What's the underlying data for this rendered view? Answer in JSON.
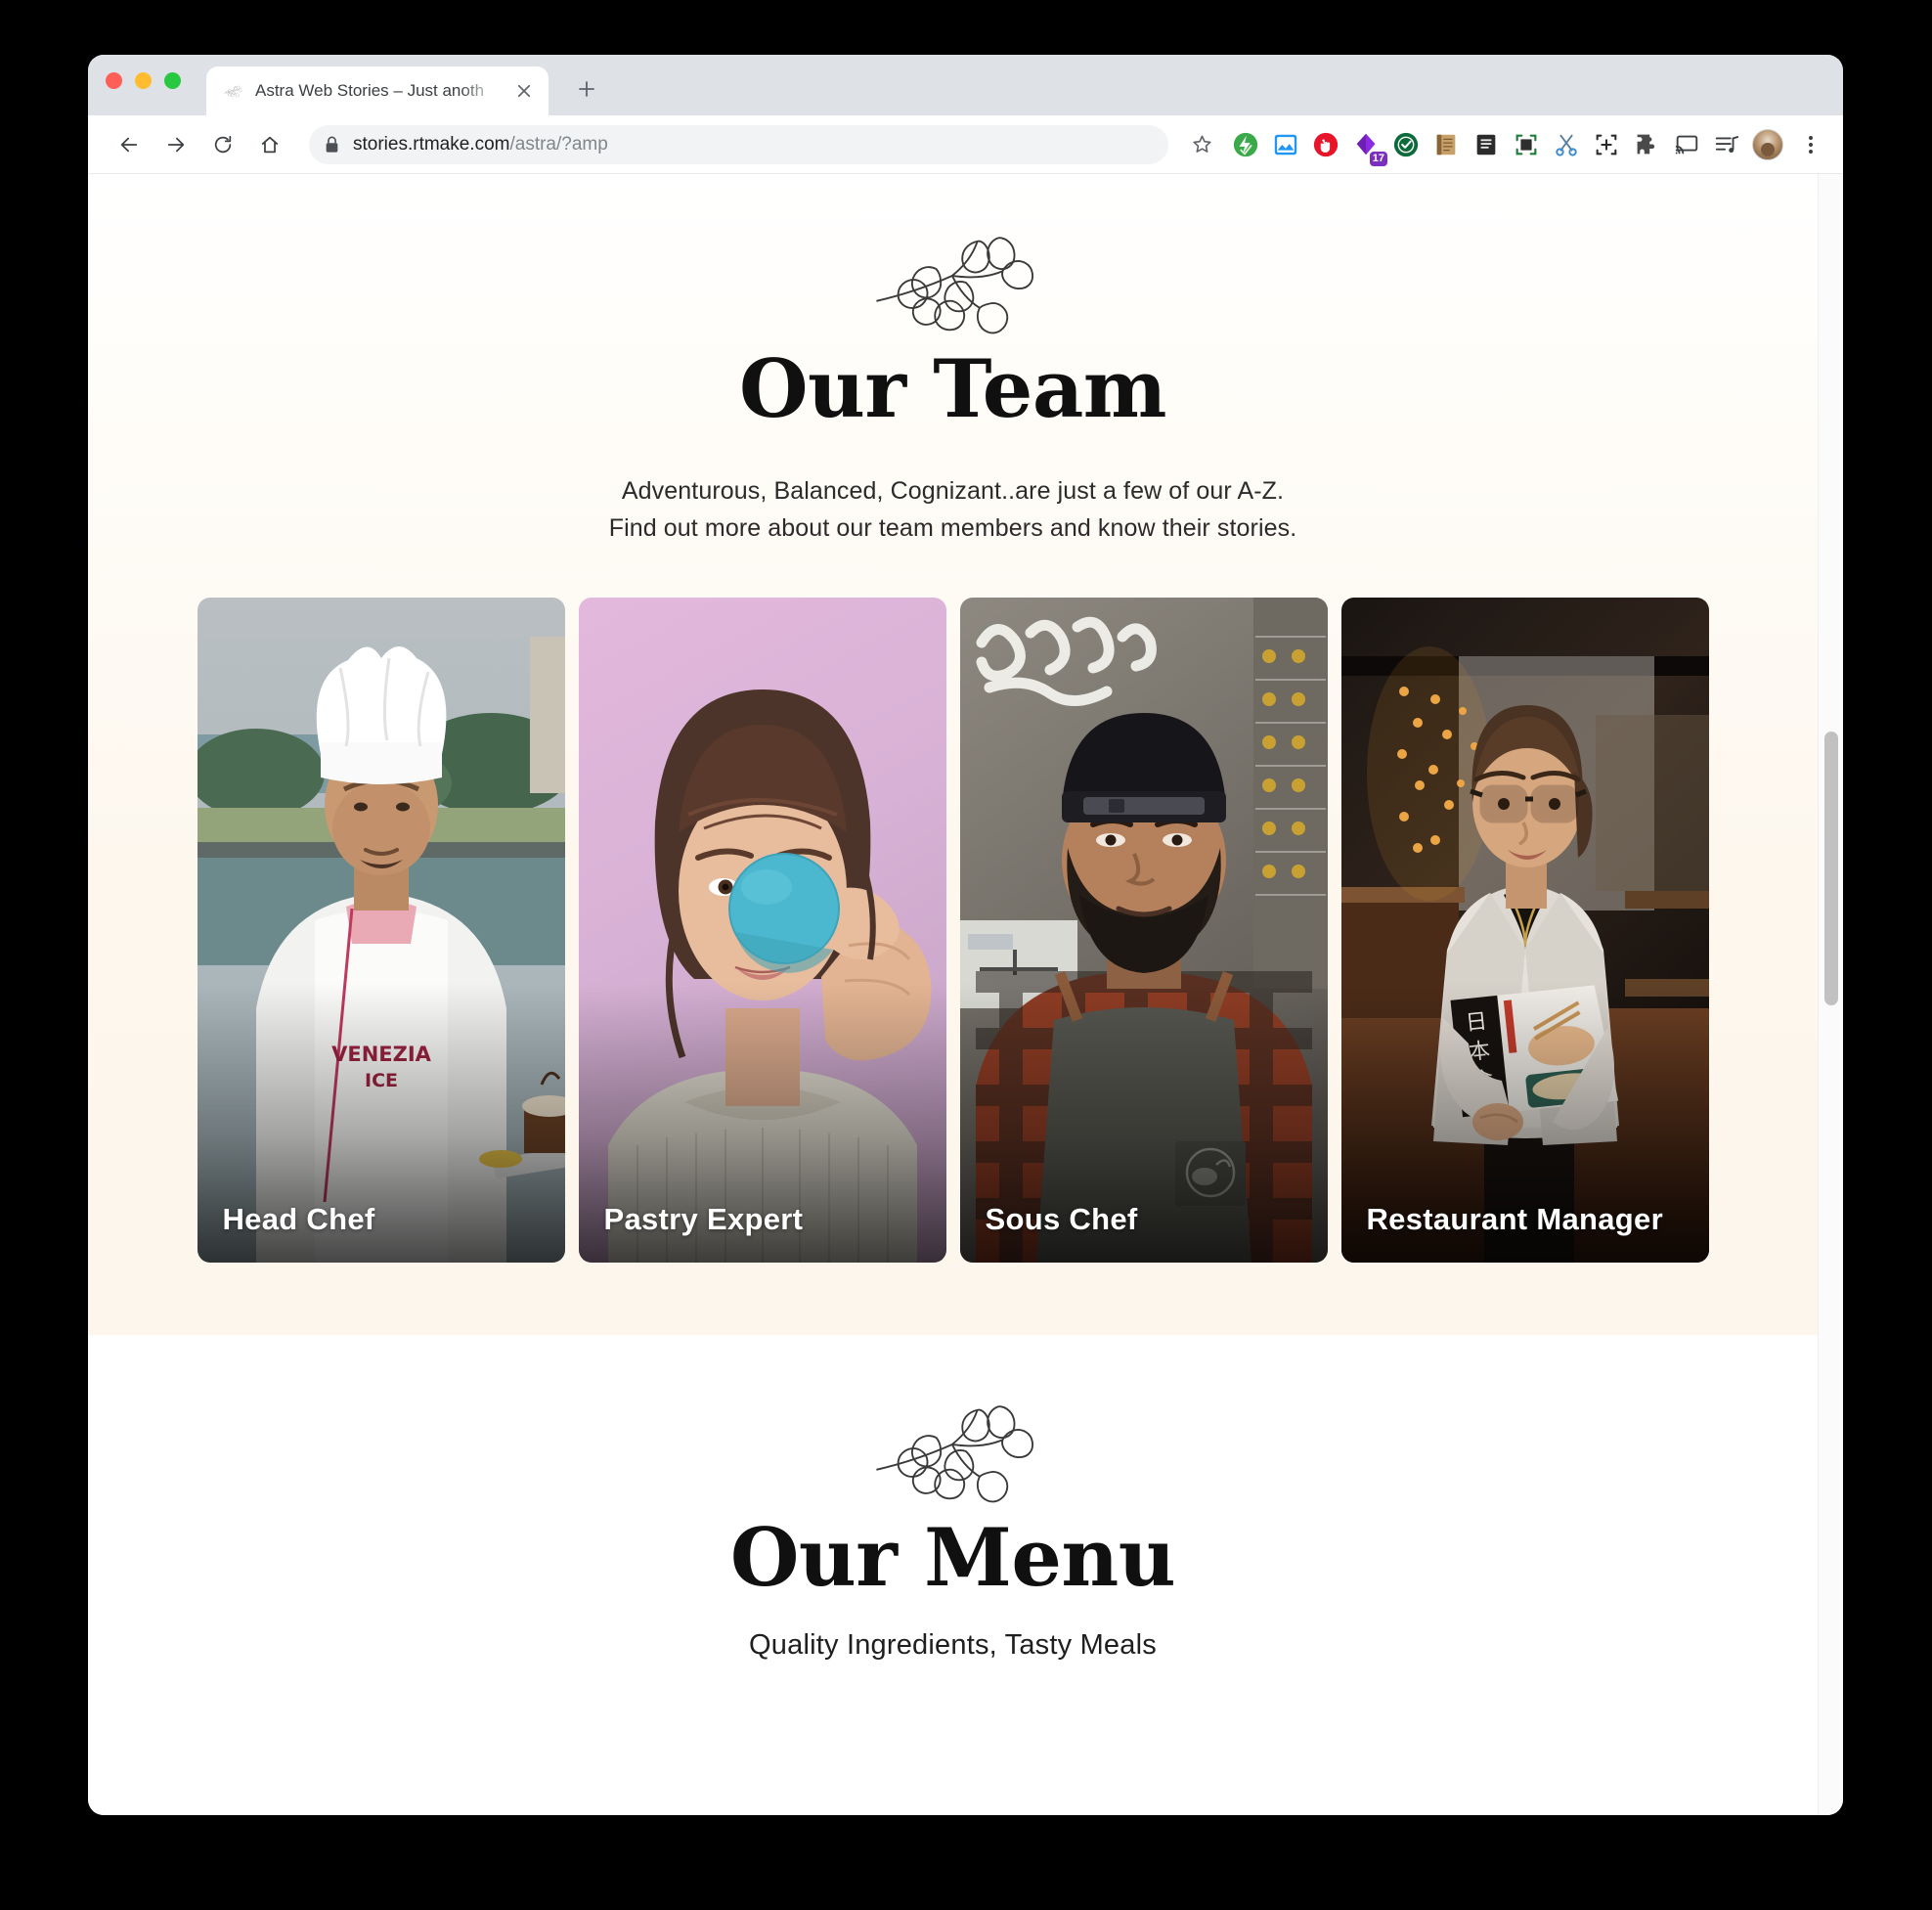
{
  "browser": {
    "tab": {
      "title": "Astra Web Stories – Just anoth",
      "favicon_icon": "leaf-branch-icon",
      "close_icon": "close-icon"
    },
    "new_tab_label": "+",
    "nav": {
      "back_icon": "arrow-back-icon",
      "forward_icon": "arrow-forward-icon",
      "reload_icon": "reload-icon",
      "home_icon": "home-icon"
    },
    "omnibox": {
      "lock_icon": "lock-icon",
      "url_host": "stories.rtmake.com",
      "url_path": "/astra/?amp",
      "bookmark_icon": "star-icon"
    },
    "extensions": [
      {
        "name": "flash-green-icon",
        "badge": null
      },
      {
        "name": "image-blue-icon",
        "badge": null
      },
      {
        "name": "stop-hand-red-icon",
        "badge": null
      },
      {
        "name": "purple-diamond-icon",
        "badge": "17"
      },
      {
        "name": "shield-check-green-icon",
        "badge": null
      },
      {
        "name": "book-ledger-icon",
        "badge": null
      },
      {
        "name": "dark-reader-icon",
        "badge": null
      },
      {
        "name": "screenshot-frame-icon",
        "badge": null
      },
      {
        "name": "scissors-icon",
        "badge": null
      },
      {
        "name": "crop-expand-icon",
        "badge": null
      },
      {
        "name": "puzzle-piece-icon",
        "badge": null
      },
      {
        "name": "cast-icon",
        "badge": null
      },
      {
        "name": "playlist-music-icon",
        "badge": null
      }
    ],
    "profile_icon": "avatar",
    "menu_icon": "kebab-menu-icon"
  },
  "team": {
    "ornament_icon": "leaf-branch-ornament",
    "title": "Our Team",
    "subtitle_line1": "Adventurous, Balanced, Cognizant..are just a few of our A-Z.",
    "subtitle_line2": "Find out more about our team members and know their stories.",
    "members": [
      {
        "role": "Head Chef",
        "image_alt": "chef-in-white-hat-and-coat-holding-dessert-plate"
      },
      {
        "role": "Pastry Expert",
        "image_alt": "young-woman-on-pink-background-holding-teal-sphere-over-eye"
      },
      {
        "role": "Sous Chef",
        "image_alt": "bearded-man-in-backwards-cap-plaid-shirt-and-gray-apron"
      },
      {
        "role": "Restaurant Manager",
        "image_alt": "woman-with-glasses-in-white-blazer-holding-japanese-food-magazine"
      }
    ]
  },
  "menu": {
    "ornament_icon": "leaf-branch-ornament",
    "title": "Our Menu",
    "subtitle": "Quality Ingredients, Tasty Meals"
  },
  "colors": {
    "team_bg": "#fdf6ec",
    "menu_bg": "#ffffff",
    "heading": "#101010",
    "card_label": "#ffffff"
  }
}
